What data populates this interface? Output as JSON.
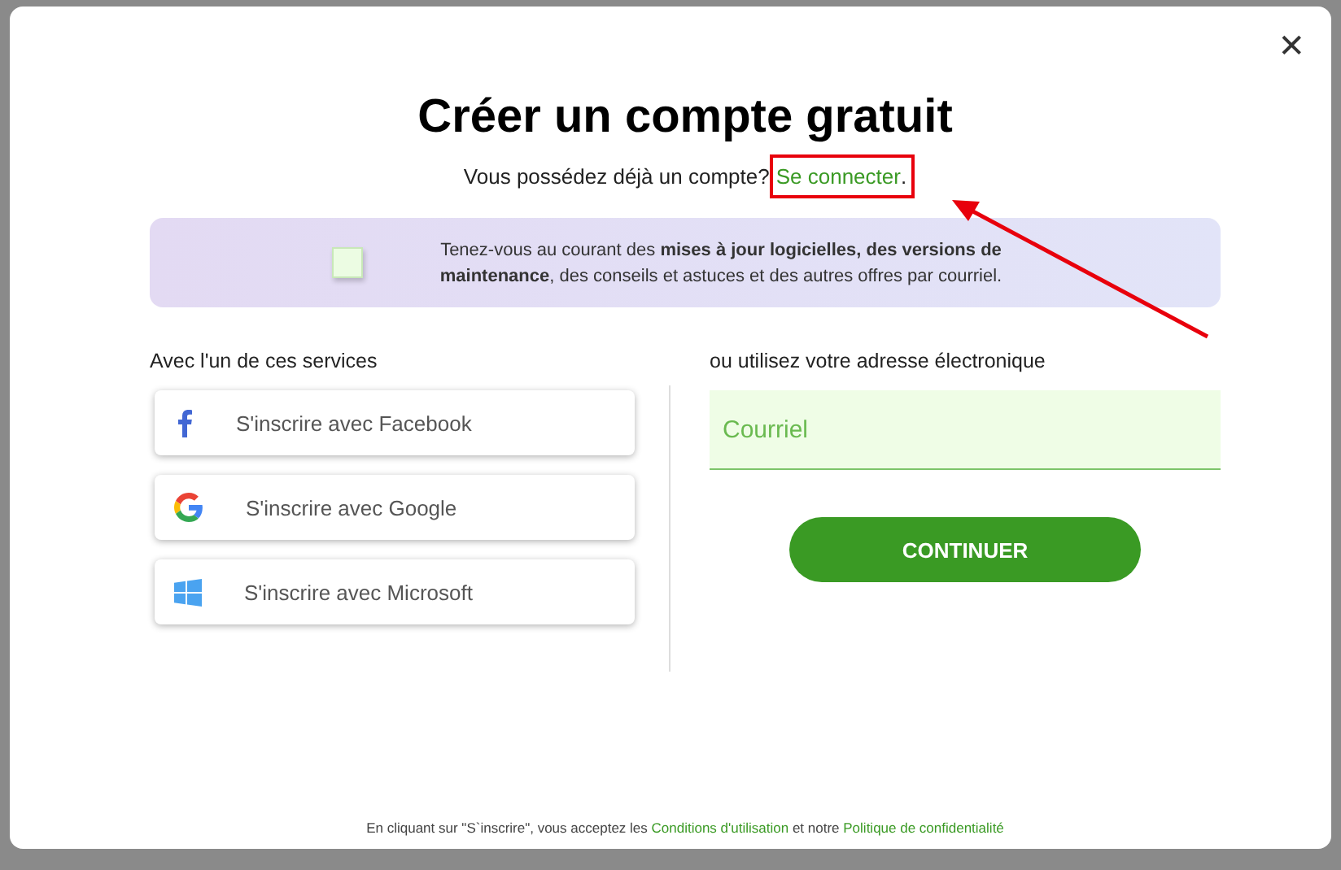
{
  "dialog": {
    "title": "Créer un compte gratuit",
    "close": "✕"
  },
  "signin": {
    "prompt": "Vous possédez déjà un compte?",
    "link": "Se connecter",
    "suffix": ".",
    "highlighted": true
  },
  "newsletter": {
    "checked": false,
    "text": "Tenez-vous au courant des **mises à jour logicielles, des versions de maintenance**, des conseils et astuces et des autres offres par courriel."
  },
  "services": {
    "heading": "Avec l'un de ces services",
    "buttons": [
      {
        "kind": "facebook",
        "label": "S'inscrire avec Facebook"
      },
      {
        "kind": "google",
        "label": "S'inscrire avec Google"
      },
      {
        "kind": "microsoft",
        "label": "S'inscrire avec Microsoft"
      }
    ]
  },
  "email": {
    "heading": "ou utilisez votre adresse électronique",
    "placeholder": "Courriel",
    "button": "CONTINUER"
  },
  "footer": {
    "parts": [
      {
        "kind": "text",
        "text": "En cliquant sur \"S`inscrire\", vous acceptez les "
      },
      {
        "kind": "link",
        "text": "Conditions d'utilisation"
      },
      {
        "kind": "text",
        "text": " et notre "
      },
      {
        "kind": "link",
        "text": "Politique de confidentialité"
      }
    ]
  }
}
